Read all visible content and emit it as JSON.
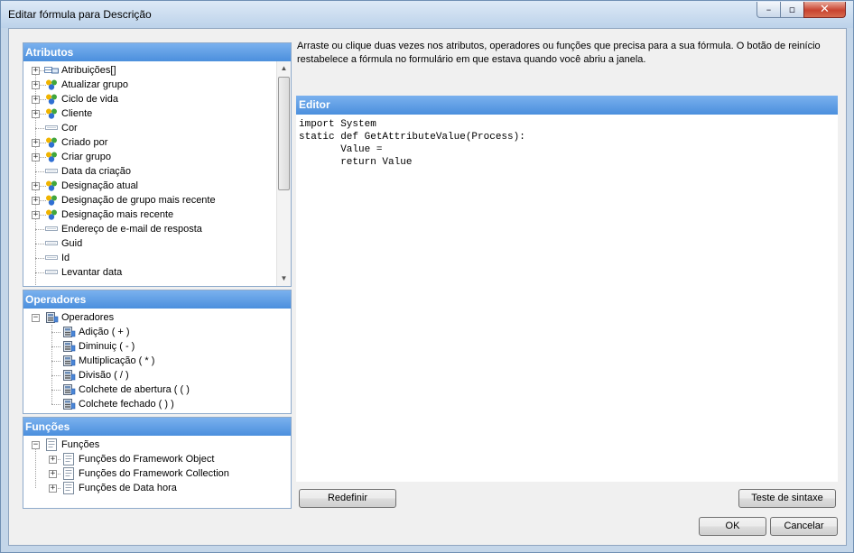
{
  "window": {
    "title": "Editar fórmula para Descrição",
    "minimize": "–",
    "maximize": "▫",
    "close": "✕"
  },
  "hint": "Arraste ou clique duas vezes nos atributos, operadores ou funções que precisa para a sua fórmula. O botão de reinício restabelece a fórmula no formulário em que estava quando você abriu a janela.",
  "attributes": {
    "header": "Atributos",
    "items": [
      {
        "label": "Atribuições[]",
        "icon": "table-icon",
        "expandable": true
      },
      {
        "label": "Atualizar grupo",
        "icon": "group-icon",
        "expandable": true
      },
      {
        "label": "Ciclo de vida",
        "icon": "group-icon",
        "expandable": true
      },
      {
        "label": "Cliente",
        "icon": "group-icon",
        "expandable": true
      },
      {
        "label": "Cor",
        "icon": "field-icon",
        "expandable": false
      },
      {
        "label": "Criado por",
        "icon": "group-icon",
        "expandable": true
      },
      {
        "label": "Criar grupo",
        "icon": "group-icon",
        "expandable": true
      },
      {
        "label": "Data da criação",
        "icon": "field-icon",
        "expandable": false
      },
      {
        "label": "Designação atual",
        "icon": "group-icon",
        "expandable": true
      },
      {
        "label": "Designação de grupo mais recente",
        "icon": "group-icon",
        "expandable": true
      },
      {
        "label": "Designação mais recente",
        "icon": "group-icon",
        "expandable": true
      },
      {
        "label": "Endereço de e-mail de resposta",
        "icon": "field-icon",
        "expandable": false
      },
      {
        "label": "Guid",
        "icon": "field-icon",
        "expandable": false
      },
      {
        "label": "Id",
        "icon": "field-icon",
        "expandable": false
      },
      {
        "label": "Levantar data",
        "icon": "field-icon",
        "expandable": false
      }
    ]
  },
  "operators": {
    "header": "Operadores",
    "root": "Operadores",
    "items": [
      "Adição ( + )",
      "Diminuiç ( - )",
      "Multiplicação ( * )",
      "Divisão ( / )",
      "Colchete de abertura ( ( )",
      "Colchete fechado ( ) )"
    ]
  },
  "functions": {
    "header": "Funções",
    "root": "Funções",
    "items": [
      "Funções do Framework Object",
      "Funções do Framework Collection",
      "Funções de Data hora"
    ]
  },
  "editor": {
    "header": "Editor",
    "code": "import System\nstatic def GetAttributeValue(Process):\n       Value =\n       return Value"
  },
  "buttons": {
    "reset": "Redefinir",
    "syntax_test": "Teste de sintaxe",
    "ok": "OK",
    "cancel": "Cancelar"
  },
  "colors": {
    "header_blue": "#4b8fdd",
    "close_red": "#c8432f"
  }
}
